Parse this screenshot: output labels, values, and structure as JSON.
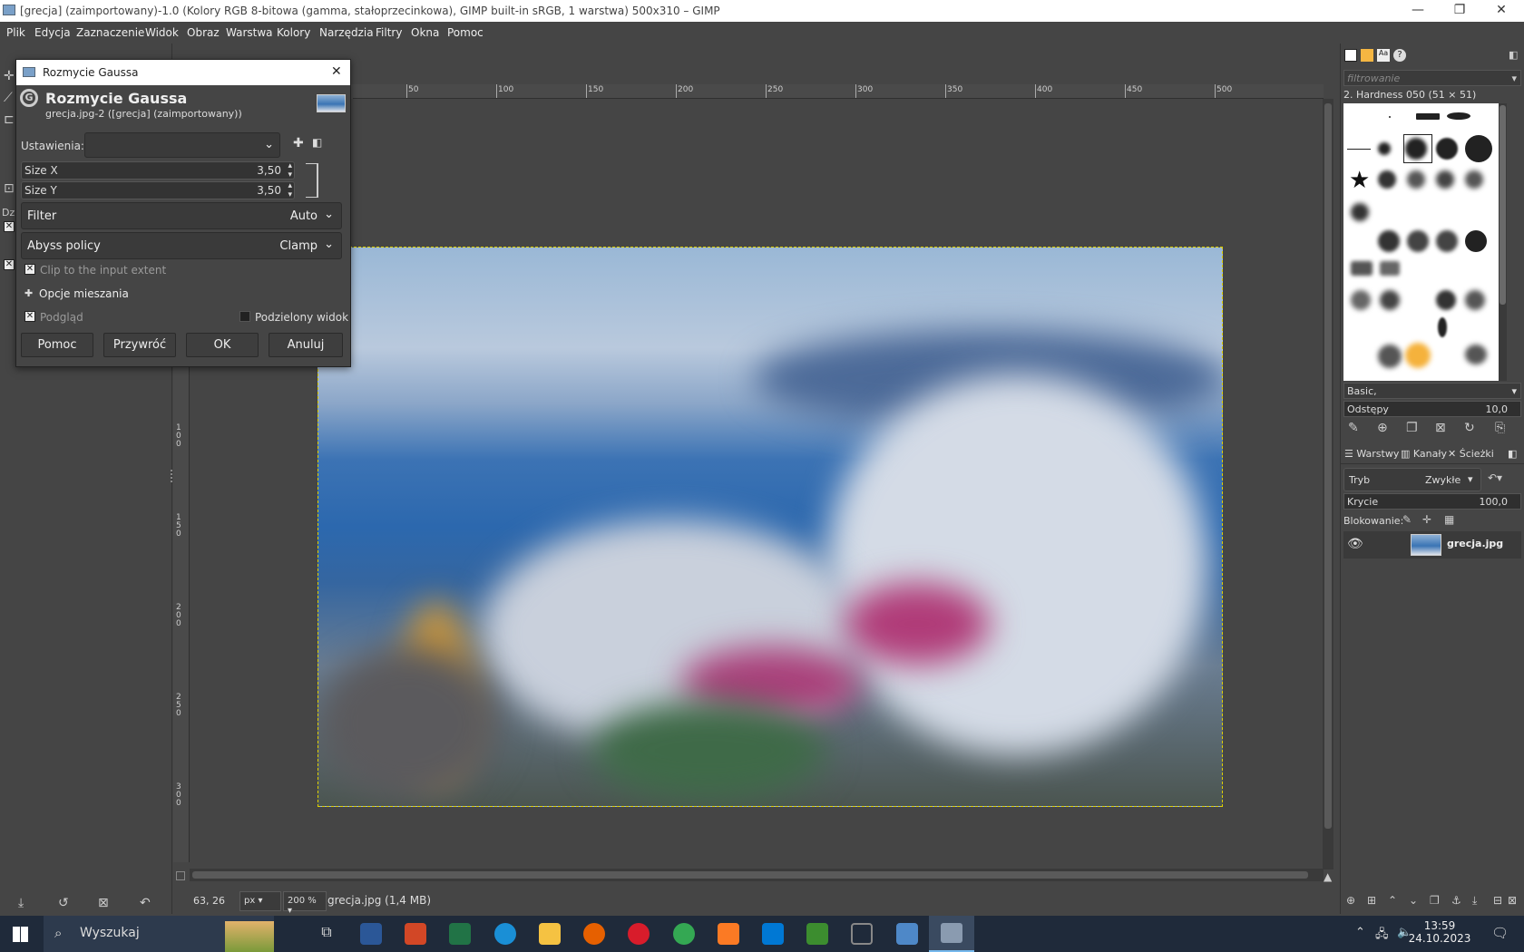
{
  "window": {
    "title": "[grecja] (zaimportowany)-1.0 (Kolory RGB 8-bitowa (gamma, stałoprzecinkowa), GIMP built-in sRGB, 1 warstwa) 500x310 – GIMP",
    "minimize": "—",
    "maximize": "❐",
    "close": "✕"
  },
  "menu": [
    "Plik",
    "Edycja",
    "Zaznaczenie",
    "Widok",
    "Obraz",
    "Warstwa",
    "Kolory",
    "Narzędzia",
    "Filtry",
    "Okna",
    "Pomoc"
  ],
  "ruler": {
    "h_ticks": [
      "50",
      "100",
      "150",
      "200",
      "250",
      "300",
      "350",
      "400",
      "450",
      "500"
    ],
    "v_ticks": [
      "1\n0\n0",
      "1\n5\n0",
      "2\n0\n0",
      "2\n5\n0",
      "3\n0\n0"
    ]
  },
  "dialog": {
    "window_title": "Rozmycie Gaussa",
    "heading": "Rozmycie Gaussa",
    "subtitle": "grecja.jpg-2 ([grecja] (zaimportowany))",
    "settings_label": "Ustawienia:",
    "settings_value": "",
    "size_x_label": "Size X",
    "size_x_value": "3,50",
    "size_y_label": "Size Y",
    "size_y_value": "3,50",
    "filter_label": "Filter",
    "filter_value": "Auto",
    "abyss_label": "Abyss policy",
    "abyss_value": "Clamp",
    "clip_label": "Clip to the input extent",
    "blend_label": "Opcje mieszania",
    "preview_label": "Podgląd",
    "split_label": "Podzielony widok",
    "buttons": {
      "help": "Pomoc",
      "reset": "Przywróć",
      "ok": "OK",
      "cancel": "Anuluj"
    },
    "close_glyph": "✕"
  },
  "left_dock": {
    "tab_label": "Dz"
  },
  "status": {
    "coords": "63, 26",
    "unit": "px",
    "zoom": "200 %",
    "file_info": "grecja.jpg (1,4 MB)"
  },
  "brushes": {
    "filter_placeholder": "filtrowanie",
    "selected": "2. Hardness 050 (51 × 51)",
    "tag": "Basic,",
    "spacing_label": "Odstępy",
    "spacing_value": "10,0"
  },
  "layers": {
    "tabs": [
      "Warstwy",
      "Kanały",
      "Ścieżki"
    ],
    "mode_label": "Tryb",
    "mode_value": "Zwykłe",
    "opacity_label": "Krycie",
    "opacity_value": "100,0",
    "lock_label": "Blokowanie:",
    "layer_name": "grecja.jpg"
  },
  "taskbar": {
    "search": "Wyszukaj",
    "time": "13:59",
    "date": "24.10.2023"
  }
}
